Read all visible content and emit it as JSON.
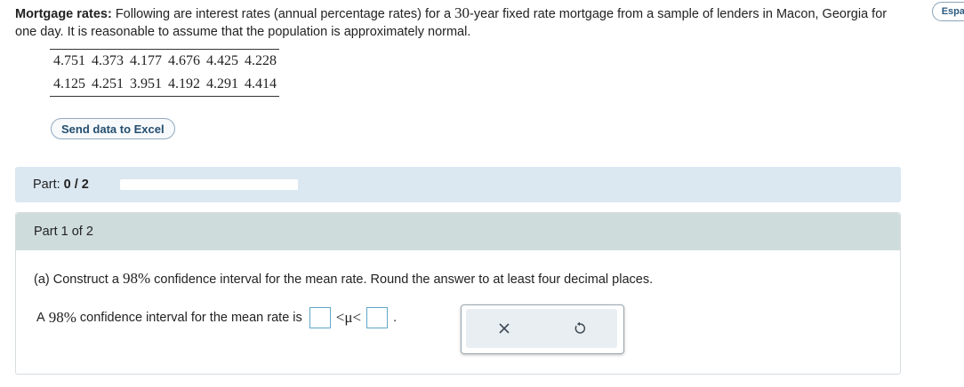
{
  "prompt": {
    "lead": "Mortgage rates:",
    "text_before_30": "Following are interest rates (annual percentage rates) for a",
    "num_30": "30",
    "text_after_30": "-year fixed rate mortgage from a sample of lenders in Macon, Georgia for one day. It is reasonable to assume that the population is approximately normal."
  },
  "language_button": "Espa",
  "data_table": {
    "rows": [
      [
        "4.751",
        "4.373",
        "4.177",
        "4.676",
        "4.425",
        "4.228"
      ],
      [
        "4.125",
        "4.251",
        "3.951",
        "4.192",
        "4.291",
        "4.414"
      ]
    ]
  },
  "excel_button": "Send data to Excel",
  "progress": {
    "label": "Part:",
    "score": "0 / 2",
    "fraction": 0
  },
  "part": {
    "header": "Part 1 of 2",
    "question_pre": "(a) Construct a",
    "question_pct": "98%",
    "question_post": "confidence interval for the mean rate. Round the answer to at least four decimal places.",
    "answer_pre": "A",
    "answer_pct": "98%",
    "answer_post": "confidence interval for the mean rate is",
    "lower_value": "",
    "relation_left": "<μ<",
    "period": "."
  },
  "tools": {
    "clear_icon": "x-icon",
    "undo_icon": "undo-icon"
  }
}
